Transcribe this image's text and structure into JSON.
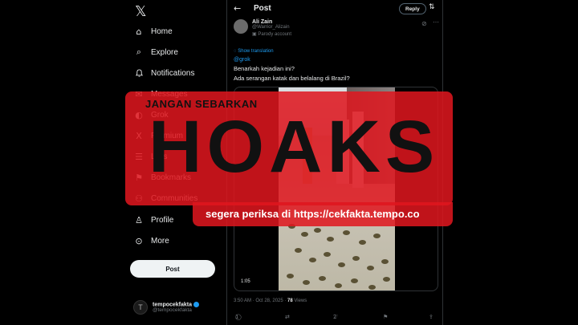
{
  "sidebar": {
    "logo": "𝕏",
    "items": [
      {
        "label": "Home",
        "icon": "home-icon",
        "glyph": "⌂"
      },
      {
        "label": "Explore",
        "icon": "search-icon",
        "glyph": "⌕"
      },
      {
        "label": "Notifications",
        "icon": "bell-icon",
        "glyph": "🔔"
      },
      {
        "label": "Messages",
        "icon": "mail-icon",
        "glyph": "✉"
      },
      {
        "label": "Grok",
        "icon": "grok-icon",
        "glyph": "◐"
      },
      {
        "label": "Premium",
        "icon": "x-premium-icon",
        "glyph": "X"
      },
      {
        "label": "Lists",
        "icon": "list-icon",
        "glyph": "☰"
      },
      {
        "label": "Bookmarks",
        "icon": "bookmark-icon",
        "glyph": "⚑"
      },
      {
        "label": "Communities",
        "icon": "communities-icon",
        "glyph": "⚇"
      },
      {
        "label": "Profile",
        "icon": "profile-icon",
        "glyph": "♙"
      },
      {
        "label": "More",
        "icon": "more-circle-icon",
        "glyph": "⊙"
      }
    ],
    "post_label": "Post",
    "account": {
      "avatar_initial": "T",
      "name": "tempocekfakta",
      "handle": "@tempocekfakta"
    }
  },
  "header": {
    "back_glyph": "←",
    "title": "Post",
    "reply_label": "Reply",
    "settings_glyph": "⇅"
  },
  "tweet": {
    "author_name": "Ali Zain",
    "author_handle": "@Warrior_Alizain",
    "parody_label": "Parody account",
    "translate_label": "Show translation",
    "mention": "@grok",
    "line1": "Benarkah kejadian ini?",
    "line2": "Ada serangan katak dan belalang di Brazil?",
    "video_duration": "1:05",
    "time": "3:50 AM · Oct 28, 2025 ·",
    "views_count": "78",
    "views_label": "Views",
    "reply_count": "1",
    "like_count": "2"
  },
  "overlay": {
    "warning": "JANGAN SEBARKAN",
    "word": "HOAKS",
    "url_text": "segera periksa di https://cekfakta.tempo.co"
  },
  "colors": {
    "accent": "#1d9bf0",
    "overlay_red": "#e0161e",
    "background": "#000000"
  }
}
